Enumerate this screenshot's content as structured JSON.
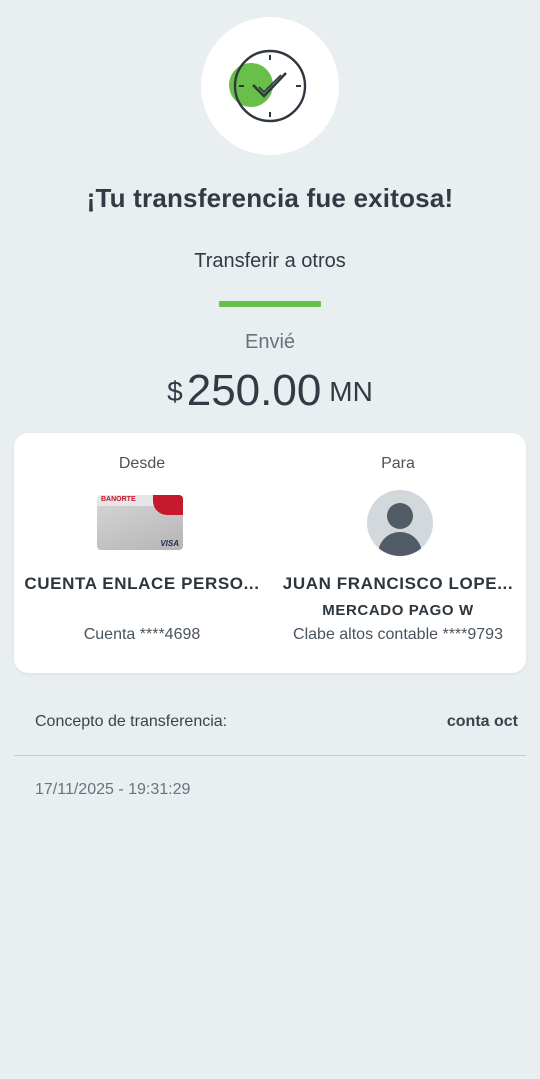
{
  "status": {
    "icon": "success-check-icon",
    "title": "¡Tu transferencia fue exitosa!",
    "subtitle": "Transferir a otros"
  },
  "amount": {
    "label": "Envié",
    "currency_symbol": "$",
    "value": "250.00",
    "unit": "MN"
  },
  "from": {
    "heading": "Desde",
    "card_brand": "BANORTE",
    "card_network": "VISA",
    "name": "CUENTA ENLACE PERSO...",
    "account": "Cuenta ****4698"
  },
  "to": {
    "heading": "Para",
    "icon": "user-avatar-icon",
    "name": "JUAN FRANCISCO LOPE...",
    "bank": "MERCADO PAGO W",
    "account": "Clabe altos contable ****9793"
  },
  "concept": {
    "label": "Concepto de transferencia:",
    "value": "conta oct"
  },
  "timestamp": "17/11/2025 - 19:31:29",
  "colors": {
    "accent": "#6abf4b",
    "background": "#e9eef1",
    "text": "#323b44"
  }
}
